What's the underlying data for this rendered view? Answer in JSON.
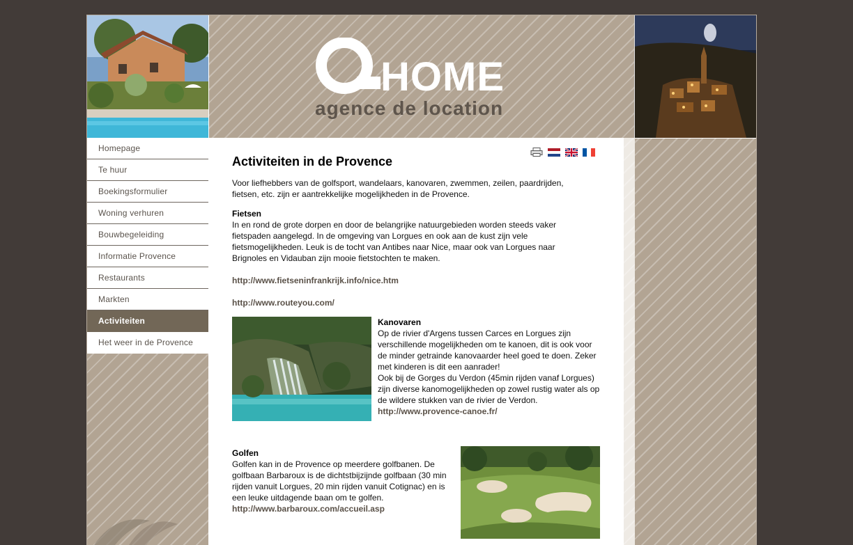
{
  "logo": {
    "home_text": "HOME",
    "sub_text": "agence de location"
  },
  "nav": {
    "items": [
      {
        "label": "Homepage"
      },
      {
        "label": "Te huur"
      },
      {
        "label": "Boekingsformulier"
      },
      {
        "label": "Woning verhuren"
      },
      {
        "label": "Bouwbegeleiding"
      },
      {
        "label": "Informatie Provence"
      },
      {
        "label": "Restaurants"
      },
      {
        "label": "Markten"
      },
      {
        "label": "Activiteiten",
        "active": true
      },
      {
        "label": "Het weer in de Provence"
      }
    ]
  },
  "toolbar": {
    "icons": [
      "print-icon",
      "flag-nl-icon",
      "flag-uk-icon",
      "flag-fr-icon"
    ]
  },
  "main": {
    "title": "Activiteiten in de Provence",
    "intro": "Voor liefhebbers van de golfsport, wandelaars, kanovaren, zwemmen, zeilen, paardrijden, fietsen, etc. zijn er aantrekkelijke mogelijkheden in de Provence.",
    "fietsen": {
      "heading": "Fietsen",
      "text": "In en rond de grote dorpen en door de belangrijke natuurgebieden worden steeds vaker fietspaden aangelegd. In de omgeving van Lorgues en ook aan de kust zijn vele fietsmogelijkheden. Leuk is de tocht van Antibes naar Nice, maar ook van Lorgues naar Brignoles en Vidauban zijn mooie fietstochten te maken.",
      "link1": "http://www.fietseninfrankrijk.info/nice.htm",
      "link2": "http://www.routeyou.com/"
    },
    "kanovaren": {
      "heading": "Kanovaren",
      "text1": "Op de rivier d'Argens tussen Carces en Lorgues zijn verschillende mogelijkheden om te kanoen, dit is ook voor de minder getrainde kanovaarder heel goed te doen. Zeker met kinderen is dit een aanrader!",
      "text2": "Ook bij de Gorges du Verdon (45min rijden vanaf Lorgues) zijn diverse kanomogelijkheden op zowel rustig water als op de wildere stukken van de rivier de Verdon.",
      "link": "http://www.provence-canoe.fr/"
    },
    "golfen": {
      "heading": "Golfen",
      "text": "Golfen kan in de Provence op meerdere golfbanen. De golfbaan Barbaroux is de dichtstbijzijnde golfbaan (30 min rijden vanuit Lorgues, 20 min rijden vanuit Cotignac) en is een leuke uitdagende baan om te golfen.",
      "link": "http://www.barbaroux.com/accueil.asp"
    }
  },
  "colors": {
    "page_bg": "#423b38",
    "stripe_bg": "#b2a493",
    "active_nav": "#726757",
    "link": "#5a5148"
  }
}
